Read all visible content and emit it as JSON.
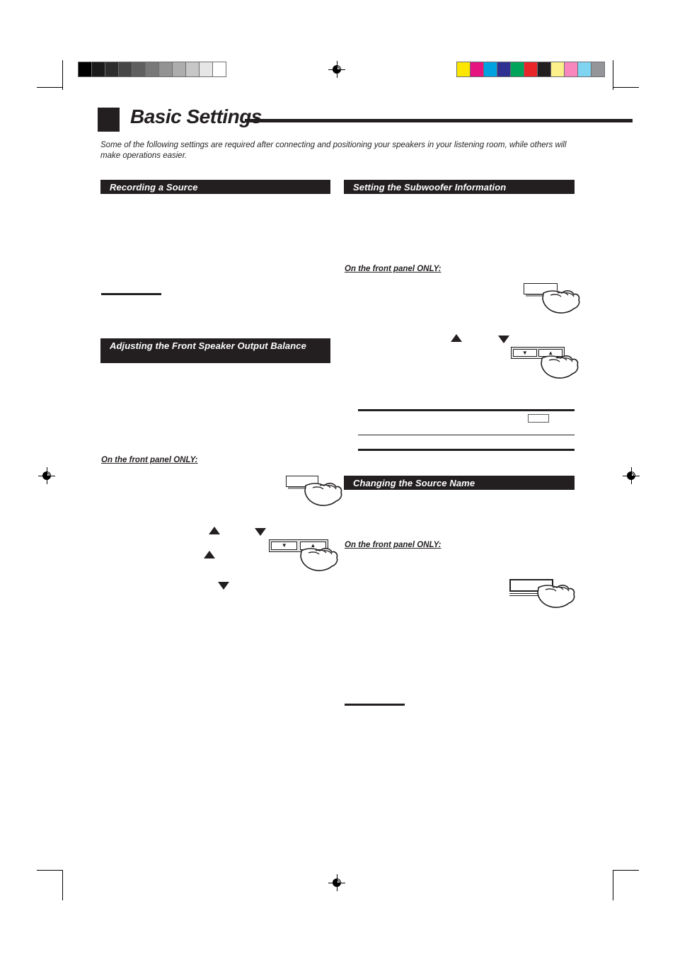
{
  "page": {
    "chapter_title": "Basic Settings",
    "intro": "Some of the following settings are required after connecting and positioning your speakers in your listening room, while others will make operations easier."
  },
  "sections": {
    "recording_a_source": "Recording a Source",
    "setting_the_subwoofer_information": "Setting the Subwoofer Information",
    "adjusting_front_speaker_balance": "Adjusting the Front Speaker Output Balance",
    "changing_the_source_name": "Changing the Source Name"
  },
  "notes": {
    "front_panel_only_subwoofer": "On the front panel ONLY:",
    "front_panel_only_balance": "On the front panel ONLY:",
    "front_panel_only_source_name": "On the front panel ONLY:"
  },
  "controls": {
    "down_arrow_glyph": "▼",
    "up_arrow_glyph": "▲"
  },
  "calibration": {
    "grayscale_label": "grayscale-calibration-bar",
    "grayscale_swatches": [
      "#000000",
      "#1b1b1b",
      "#2e2e2e",
      "#474747",
      "#5f5f5f",
      "#787878",
      "#939393",
      "#adadad",
      "#c7c7c7",
      "#e6e6e6",
      "#ffffff"
    ],
    "color_label": "color-calibration-bar",
    "color_swatches": [
      "#fde700",
      "#e5147f",
      "#00a3e0",
      "#2e3192",
      "#00a45b",
      "#e8262a",
      "#231f20",
      "#fbf08a",
      "#f887be",
      "#7fd4f2",
      "#949599"
    ]
  }
}
